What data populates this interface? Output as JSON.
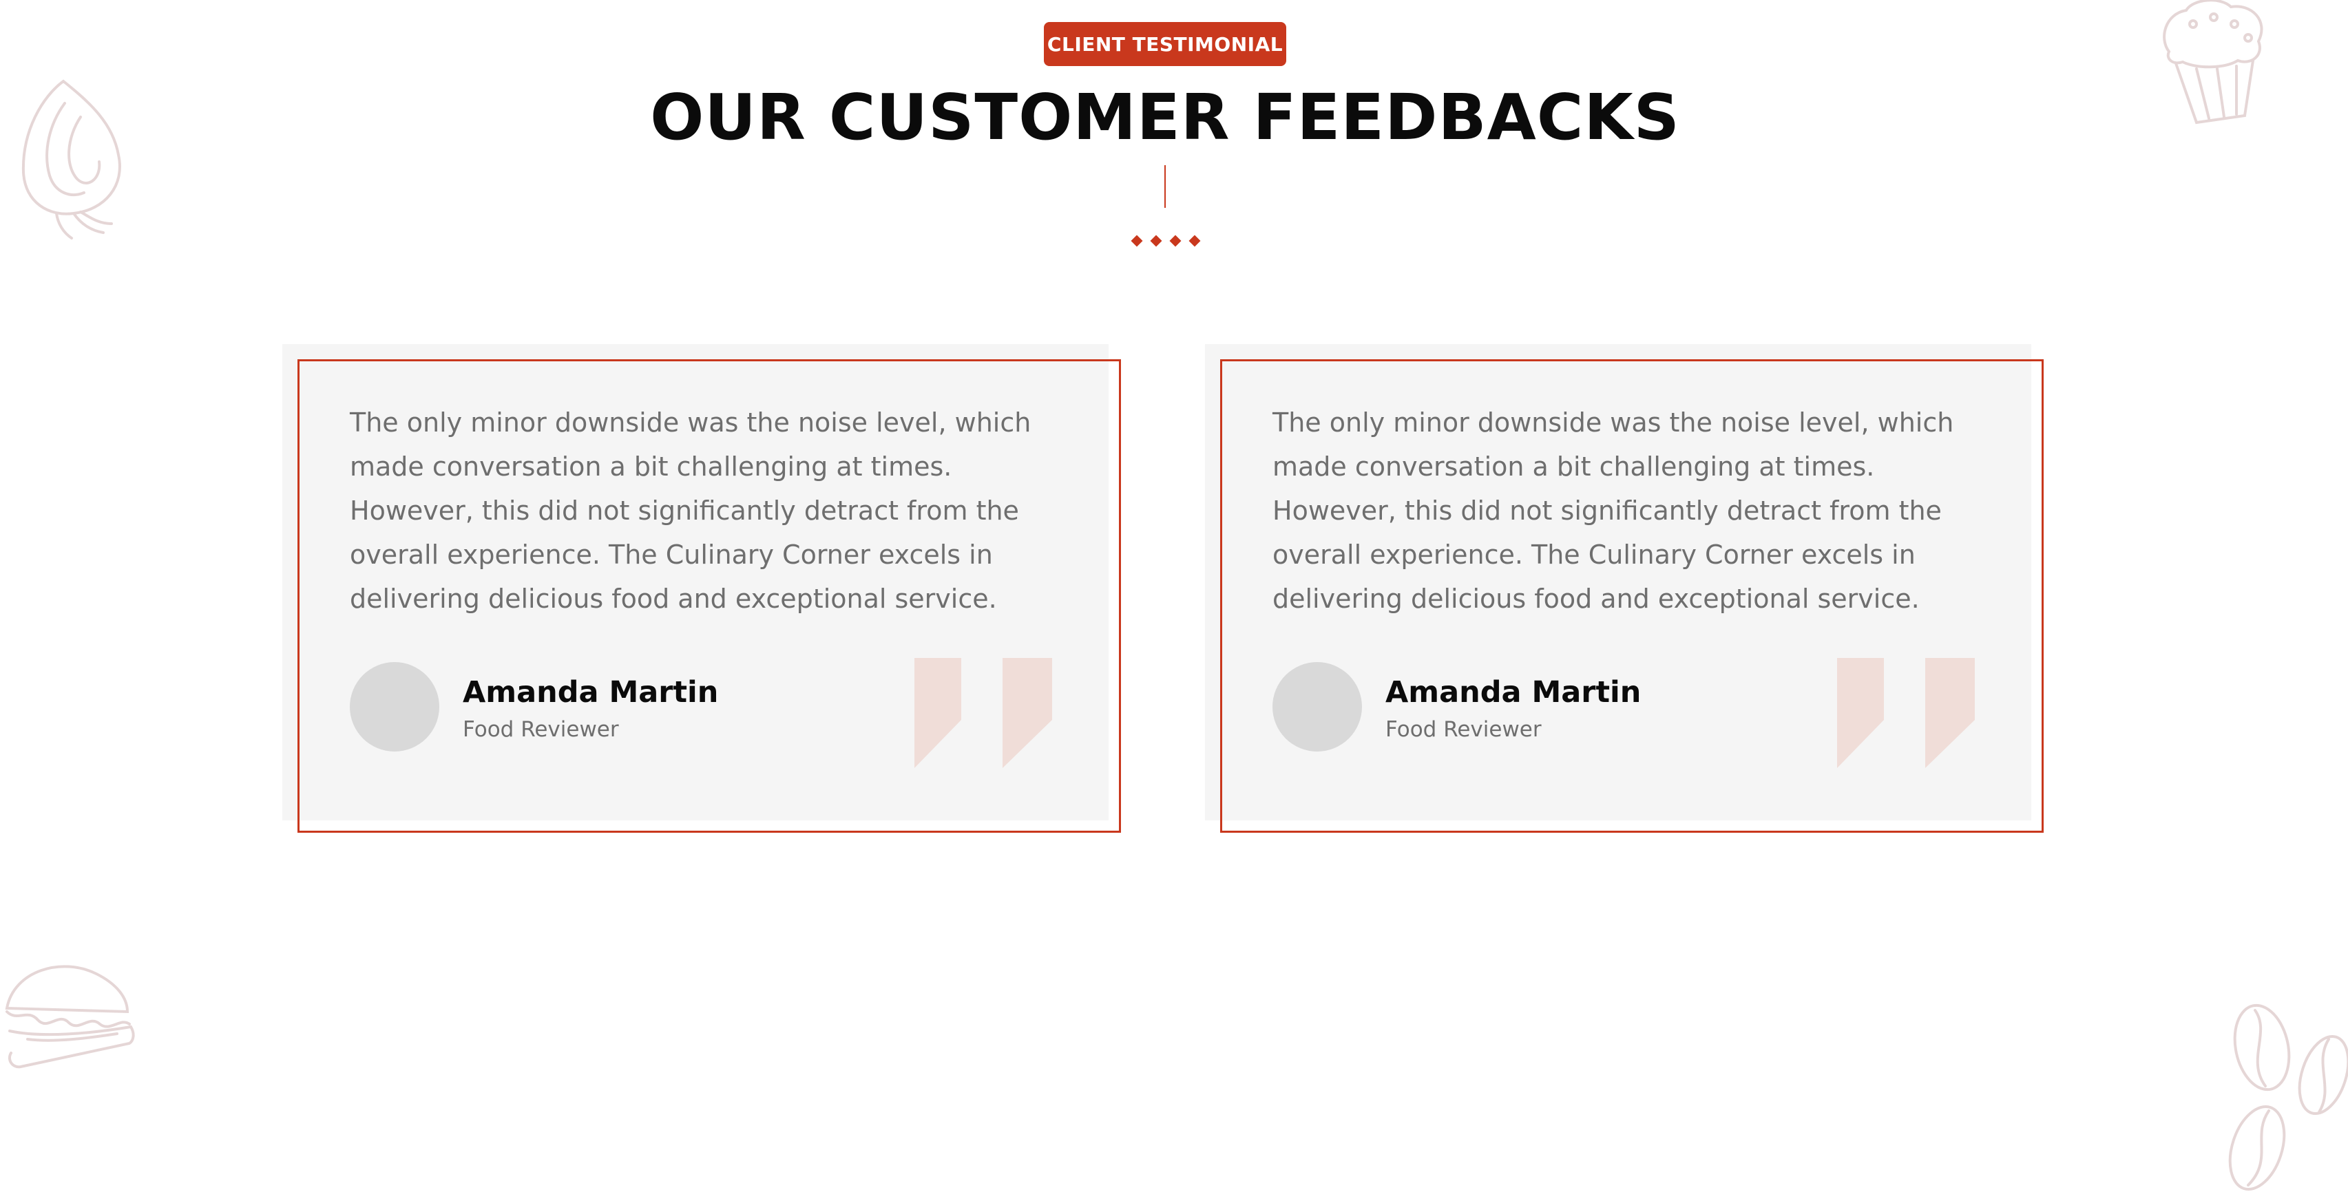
{
  "header": {
    "badge_label": "CLIENT TESTIMONIAL",
    "title": "OUR CUSTOMER FEEDBACKS"
  },
  "testimonials": [
    {
      "text": "The only minor downside was the noise level, which made conversation a bit challenging at times. However, this did not significantly detract from the overall experience. The Culinary Corner excels in delivering delicious food and exceptional service.",
      "author_name": "Amanda Martin",
      "author_role": "Food Reviewer"
    },
    {
      "text": "The only minor downside was the noise level, which made conversation a bit challenging at times. However, this did not significantly detract from the overall experience. The Culinary Corner excels in delivering delicious food and exceptional service.",
      "author_name": "Amanda Martin",
      "author_role": "Food Reviewer"
    }
  ],
  "colors": {
    "accent": "#c9381d",
    "card_background": "#f5f5f5",
    "quote_mark": "#f0ddd8",
    "doodle_stroke": "#e5d6d6"
  },
  "icons": {
    "decorations": [
      "onion-doodle-icon",
      "muffin-doodle-icon",
      "burger-doodle-icon",
      "coffee-beans-doodle-icon"
    ],
    "separator": "diamond-dots-icon",
    "quote": "quote-mark-icon"
  }
}
